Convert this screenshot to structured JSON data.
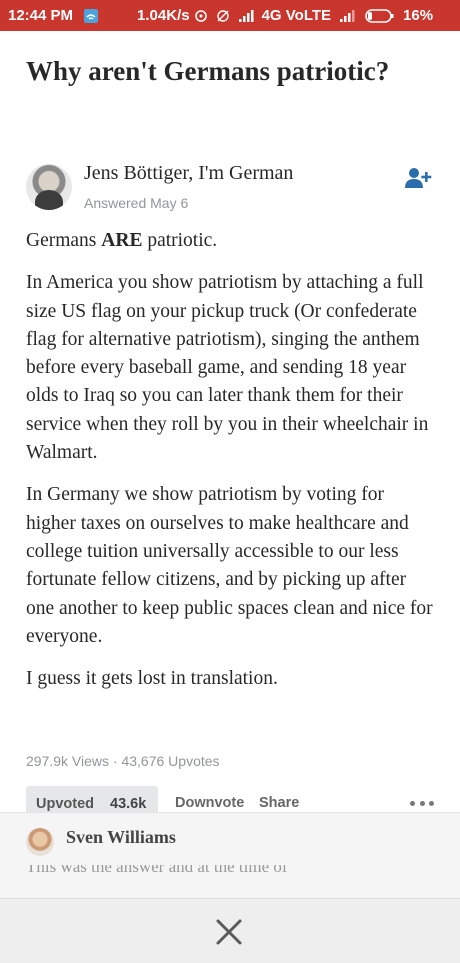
{
  "status_bar": {
    "time": "12:44 PM",
    "speed": "1.04K/s",
    "network": "4G VoLTE",
    "battery": "16%",
    "background_color": "#c8362e"
  },
  "question": {
    "title": "Why aren't Germans patriotic?"
  },
  "answer": {
    "author": "Jens Böttiger, I'm German",
    "meta": "Answered May 6",
    "paragraphs": {
      "p1_prefix": "Germans ",
      "p1_bold": "ARE",
      "p1_suffix": " patriotic.",
      "p2": "In America you show patriotism by attaching a full size US flag on your pickup truck (Or confederate flag for alternative patriotism), singing the anthem before every baseball game, and sending 18 year olds to Iraq so you can later thank them for their service when they roll by you in their wheelchair in Walmart.",
      "p3": "In Germany we show patriotism by voting for higher taxes on ourselves to make healthcare and college tuition universally accessible to our less fortunate fellow citizens, and by picking up after one another to keep public spaces clean and nice for everyone.",
      "p4": "I guess it gets lost in translation."
    },
    "stats": "297.9k Views · 43,676 Upvotes"
  },
  "actions": {
    "upvote_label": "Upvoted",
    "upvote_count": "43.6k",
    "downvote_label": "Downvote",
    "share_label": "Share"
  },
  "comment": {
    "author": "Sven Williams",
    "snippet": "This was the answer and at the time of"
  },
  "icons": {
    "follow": "add-person-icon",
    "more": "more-dots-icon",
    "close": "close-icon",
    "accent": "#2b6dad"
  }
}
